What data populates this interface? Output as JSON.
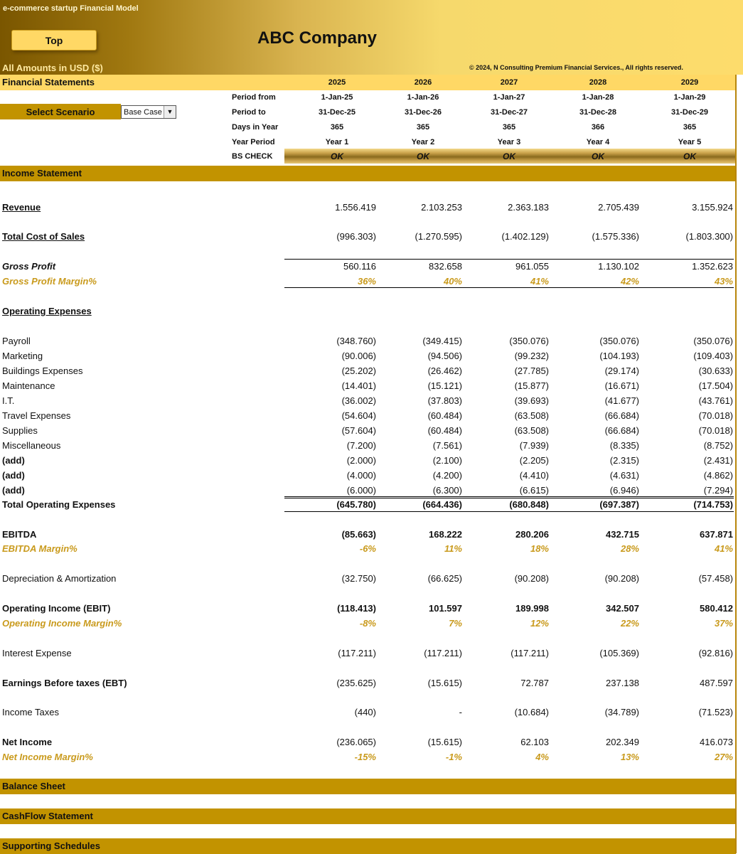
{
  "app_title": "e-commerce startup Financial  Model",
  "top_button": "Top",
  "company": "ABC Company",
  "amounts_label": "All Amounts in  USD ($)",
  "copyright": "© 2024, N Consulting Premium Financial Services., All rights reserved.",
  "financial_statements": "Financial Statements",
  "years": [
    "2025",
    "2026",
    "2027",
    "2028",
    "2029"
  ],
  "scenario": {
    "label": "Select Scenario",
    "value": "Base Case"
  },
  "period_rows": [
    {
      "label": "Period from",
      "values": [
        "1-Jan-25",
        "1-Jan-26",
        "1-Jan-27",
        "1-Jan-28",
        "1-Jan-29"
      ]
    },
    {
      "label": "Period to",
      "values": [
        "31-Dec-25",
        "31-Dec-26",
        "31-Dec-27",
        "31-Dec-28",
        "31-Dec-29"
      ]
    },
    {
      "label": "Days in Year",
      "values": [
        "365",
        "365",
        "365",
        "366",
        "365"
      ]
    },
    {
      "label": "Year Period",
      "values": [
        "Year 1",
        "Year 2",
        "Year 3",
        "Year 4",
        "Year 5"
      ]
    },
    {
      "label": "BS CHECK",
      "values": [
        "OK",
        "OK",
        "OK",
        "OK",
        "OK"
      ]
    }
  ],
  "sections": {
    "income_statement": "Income Statement",
    "balance_sheet": "Balance Sheet",
    "cashflow": "CashFlow Statement",
    "supporting": "Supporting Schedules"
  },
  "rows": {
    "revenue": {
      "label": "Revenue",
      "values": [
        "1.556.419",
        "2.103.253",
        "2.363.183",
        "2.705.439",
        "3.155.924"
      ]
    },
    "cos": {
      "label": "Total Cost of Sales",
      "values": [
        "(996.303)",
        "(1.270.595)",
        "(1.402.129)",
        "(1.575.336)",
        "(1.803.300)"
      ]
    },
    "gp": {
      "label": "Gross Profit",
      "values": [
        "560.116",
        "832.658",
        "961.055",
        "1.130.102",
        "1.352.623"
      ]
    },
    "gpm": {
      "label": "Gross Profit Margin%",
      "values": [
        "36%",
        "40%",
        "41%",
        "42%",
        "43%"
      ]
    },
    "opex_head": {
      "label": "Operating Expenses"
    },
    "opex": [
      {
        "label": "Payroll",
        "values": [
          "(348.760)",
          "(349.415)",
          "(350.076)",
          "(350.076)",
          "(350.076)"
        ]
      },
      {
        "label": "Marketing",
        "values": [
          "(90.006)",
          "(94.506)",
          "(99.232)",
          "(104.193)",
          "(109.403)"
        ]
      },
      {
        "label": "Buildings Expenses",
        "values": [
          "(25.202)",
          "(26.462)",
          "(27.785)",
          "(29.174)",
          "(30.633)"
        ]
      },
      {
        "label": "Maintenance",
        "values": [
          "(14.401)",
          "(15.121)",
          "(15.877)",
          "(16.671)",
          "(17.504)"
        ]
      },
      {
        "label": "I.T.",
        "values": [
          "(36.002)",
          "(37.803)",
          "(39.693)",
          "(41.677)",
          "(43.761)"
        ]
      },
      {
        "label": "Travel Expenses",
        "values": [
          "(54.604)",
          "(60.484)",
          "(63.508)",
          "(66.684)",
          "(70.018)"
        ]
      },
      {
        "label": "Supplies",
        "values": [
          "(57.604)",
          "(60.484)",
          "(63.508)",
          "(66.684)",
          "(70.018)"
        ]
      },
      {
        "label": "Miscellaneous",
        "values": [
          "(7.200)",
          "(7.561)",
          "(7.939)",
          "(8.335)",
          "(8.752)"
        ]
      },
      {
        "label": "(add)",
        "values": [
          "(2.000)",
          "(2.100)",
          "(2.205)",
          "(2.315)",
          "(2.431)"
        ]
      },
      {
        "label": "(add)",
        "values": [
          "(4.000)",
          "(4.200)",
          "(4.410)",
          "(4.631)",
          "(4.862)"
        ]
      },
      {
        "label": "(add)",
        "values": [
          "(6.000)",
          "(6.300)",
          "(6.615)",
          "(6.946)",
          "(7.294)"
        ]
      }
    ],
    "total_opex": {
      "label": "Total Operating Expenses",
      "values": [
        "(645.780)",
        "(664.436)",
        "(680.848)",
        "(697.387)",
        "(714.753)"
      ]
    },
    "ebitda": {
      "label": "EBITDA",
      "values": [
        "(85.663)",
        "168.222",
        "280.206",
        "432.715",
        "637.871"
      ]
    },
    "ebitda_m": {
      "label": "EBITDA Margin%",
      "values": [
        "-6%",
        "11%",
        "18%",
        "28%",
        "41%"
      ]
    },
    "da": {
      "label": "Depreciation & Amortization",
      "values": [
        "(32.750)",
        "(66.625)",
        "(90.208)",
        "(90.208)",
        "(57.458)"
      ]
    },
    "ebit": {
      "label": "Operating Income (EBIT)",
      "values": [
        "(118.413)",
        "101.597",
        "189.998",
        "342.507",
        "580.412"
      ]
    },
    "ebit_m": {
      "label": "Operating Income Margin%",
      "values": [
        "-8%",
        "7%",
        "12%",
        "22%",
        "37%"
      ]
    },
    "interest": {
      "label": "Interest Expense",
      "values": [
        "(117.211)",
        "(117.211)",
        "(117.211)",
        "(105.369)",
        "(92.816)"
      ]
    },
    "ebt": {
      "label": "Earnings Before taxes (EBT)",
      "values": [
        "(235.625)",
        "(15.615)",
        "72.787",
        "237.138",
        "487.597"
      ]
    },
    "tax": {
      "label": "Income Taxes",
      "values": [
        "(440)",
        "-",
        "(10.684)",
        "(34.789)",
        "(71.523)"
      ]
    },
    "ni": {
      "label": "Net Income",
      "values": [
        "(236.065)",
        "(15.615)",
        "62.103",
        "202.349",
        "416.073"
      ]
    },
    "ni_m": {
      "label": "Net Income Margin%",
      "values": [
        "-15%",
        "-1%",
        "4%",
        "13%",
        "27%"
      ]
    }
  }
}
